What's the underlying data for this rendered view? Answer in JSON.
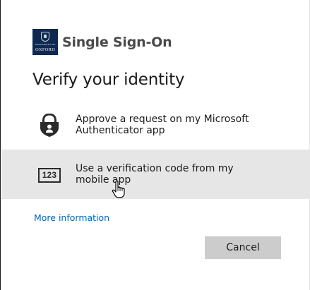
{
  "brand": {
    "logo_text_top": "UNIVERSITY OF",
    "logo_text_bottom": "OXFORD",
    "title": "Single Sign-On",
    "logo_color": "#0f2850"
  },
  "heading": "Verify your identity",
  "options": [
    {
      "icon": "lock-shield-icon",
      "label": "Approve a request on my Microsoft Authenticator app"
    },
    {
      "icon": "verification-code-icon",
      "icon_text": "123",
      "label": "Use a verification code from my mobile app",
      "highlighted": true
    }
  ],
  "more_info_link": "More information",
  "cancel_button": "Cancel",
  "colors": {
    "link": "#0067b8",
    "highlight": "#e6e6e6",
    "button": "#cccccc"
  }
}
